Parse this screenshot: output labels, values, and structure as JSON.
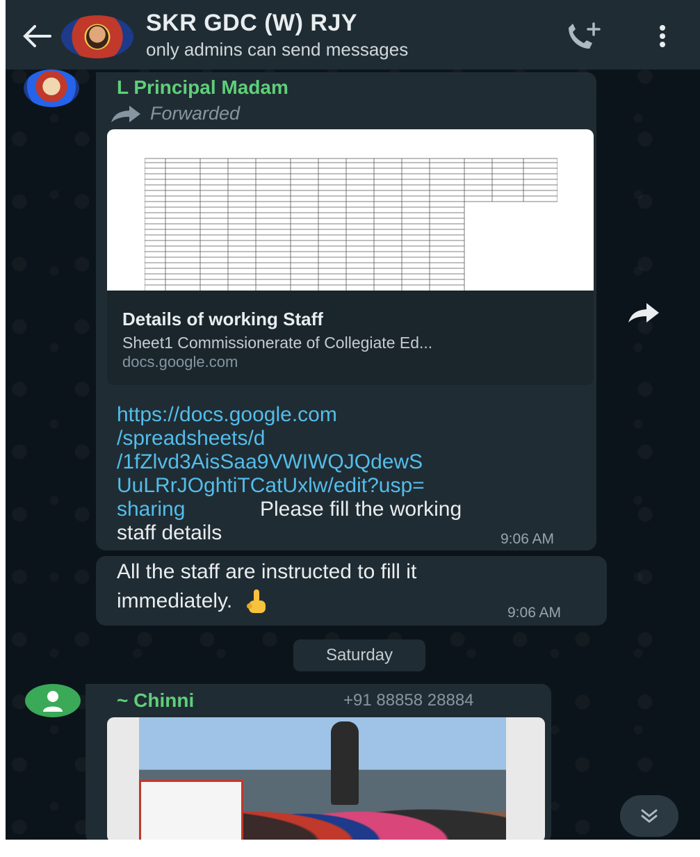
{
  "header": {
    "group_name": "SKR GDC (W) RJY",
    "status": "only admins can send messages",
    "icons": [
      "back-arrow-icon",
      "group-avatar",
      "add-call-icon",
      "more-options-icon"
    ]
  },
  "messages": [
    {
      "sender": "L Principal Madam",
      "forwarded_label": "Forwarded",
      "link_preview": {
        "title": "Details of working Staff",
        "description": "Sheet1 Commissionerate of Collegiate Ed...",
        "domain": "docs.google.com"
      },
      "link_lines": [
        "https://docs.google.com",
        "/spreadsheets/d",
        "/1fZlvd3AisSaa9VWIWQJQdewS",
        "UuLRrJOghtiTCatUxlw/edit?usp=",
        "sharing"
      ],
      "text_after_link": "Please fill the working",
      "text_line2": "staff details",
      "time": "9:06 AM"
    },
    {
      "text_line1": "All the staff are instructed to fill it",
      "text_line2": "immediately.",
      "emoji": "point-up-icon",
      "time": "9:06 AM"
    }
  ],
  "date_chip": "Saturday",
  "photo_message": {
    "sender": "~ Chinni",
    "phone": "+91 88858 28884"
  },
  "colors": {
    "background": "#0b141a",
    "bubble": "#202c33",
    "header": "#1f2c33",
    "sender_name": "#5fcf7a",
    "link": "#53bdeb"
  }
}
